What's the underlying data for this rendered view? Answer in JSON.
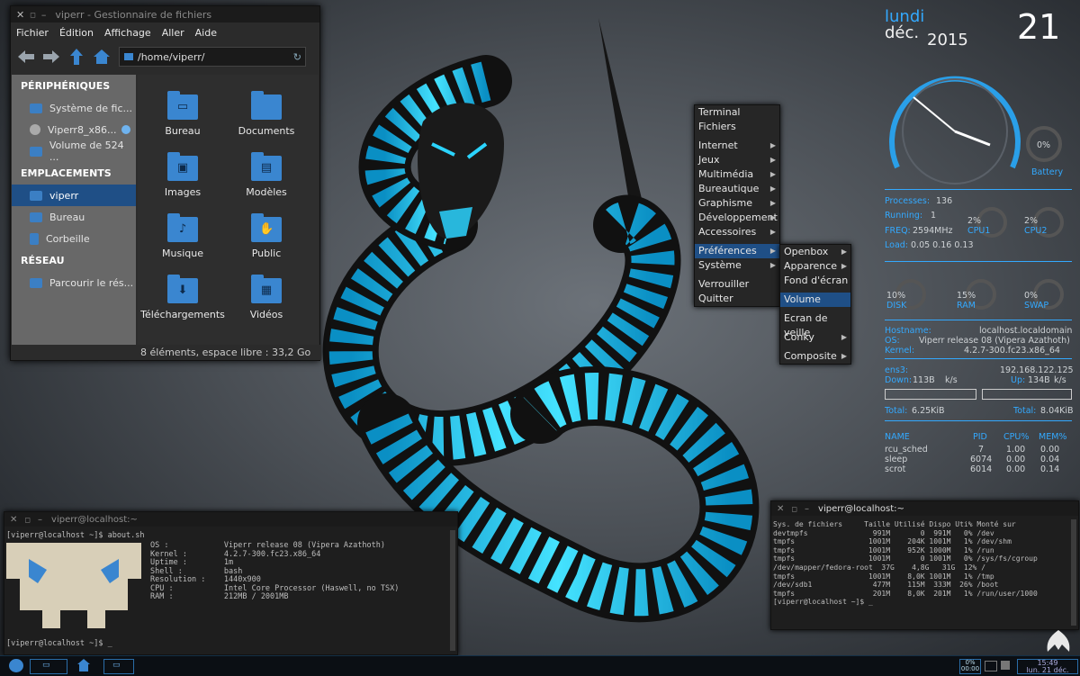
{
  "colors": {
    "accent": "#33a9ff",
    "selection": "#1f4f86",
    "folder": "#3a86d0",
    "snake_glow": "#2bd4ff"
  },
  "file_manager": {
    "title": "viperr - Gestionnaire de fichiers",
    "menus": [
      "Fichier",
      "Édition",
      "Affichage",
      "Aller",
      "Aide"
    ],
    "path": "/home/viperr/",
    "sections": [
      {
        "title": "PÉRIPHÉRIQUES",
        "items": [
          "Système de fic...",
          "Viperr8_x86...",
          "Volume de 524 ..."
        ]
      },
      {
        "title": "EMPLACEMENTS",
        "items": [
          "viperr",
          "Bureau",
          "Corbeille"
        ]
      },
      {
        "title": "RÉSEAU",
        "items": [
          "Parcourir le rés..."
        ]
      }
    ],
    "files": [
      "Bureau",
      "Documents",
      "Images",
      "Modèles",
      "Musique",
      "Public",
      "Téléchargements",
      "Vidéos"
    ],
    "status": "8 éléments, espace libre : 33,2 Go"
  },
  "menu": {
    "items": [
      "Terminal",
      "Fichiers",
      "Internet",
      "Jeux",
      "Multimédia",
      "Bureautique",
      "Graphisme",
      "Développement",
      "Accessoires",
      "Préférences",
      "Système",
      "Verrouiller",
      "Quitter"
    ],
    "submenu": [
      "Openbox",
      "Apparence",
      "Fond d'écran",
      "Volume",
      "Ecran de veille",
      "Conky",
      "Composite"
    ]
  },
  "conky": {
    "day": "lundi",
    "month": "déc.",
    "year": "2015",
    "date": "21",
    "battery_pct": "0%",
    "battery_label": "Battery",
    "processes_label": "Processes:",
    "processes": "136",
    "running_label": "Running:",
    "running": "1",
    "freq_label": "FREQ:",
    "freq": "2594MHz",
    "load_label": "Load:",
    "load": "0.05 0.16 0.13",
    "cpu1_pct": "2%",
    "cpu1_label": "CPU1",
    "cpu2_pct": "2%",
    "cpu2_label": "CPU2",
    "disk_pct": "10%",
    "disk_label": "DISK",
    "ram_pct": "15%",
    "ram_label": "RAM",
    "swap_pct": "0%",
    "swap_label": "SWAP",
    "hostname_label": "Hostname:",
    "hostname": "localhost.localdomain",
    "os_label": "OS:",
    "os": "Viperr release 08 (Vipera Azathoth)",
    "kernel_label": "Kernel:",
    "kernel": "4.2.7-300.fc23.x86_64",
    "iface_label": "ens3:",
    "ip": "192.168.122.125",
    "down_label": "Down:",
    "down": "113B",
    "down_unit": "k/s",
    "up_label": "Up:",
    "up": "134B",
    "up_unit": "k/s",
    "total_label": "Total:",
    "total_down": "6.25KiB",
    "total_up": "8.04KiB",
    "proc_headers": [
      "NAME",
      "PID",
      "CPU%",
      "MEM%"
    ],
    "procs": [
      [
        "rcu_sched",
        "7",
        "1.00",
        "0.00"
      ],
      [
        "sleep",
        "6074",
        "0.00",
        "0.04"
      ],
      [
        "scrot",
        "6014",
        "0.00",
        "0.14"
      ]
    ]
  },
  "term1": {
    "title": "viperr@localhost:~",
    "prompt1": "[viperr@localhost ~]$ about.sh",
    "info": "OS :            Viperr release 08 (Vipera Azathoth)\nKernel :        4.2.7-300.fc23.x86_64\nUptime :        1m\nShell :         bash\nResolution :    1440x900\nCPU :           Intel Core Processor (Haswell, no TSX)\nRAM :           212MB / 2001MB",
    "prompt2": "[viperr@localhost ~]$ _"
  },
  "term2": {
    "title": "viperr@localhost:~",
    "body": "Sys. de fichiers     Taille Utilisé Dispo Uti% Monté sur\ndevtmpfs               991M       0  991M   0% /dev\ntmpfs                 1001M    204K 1001M   1% /dev/shm\ntmpfs                 1001M    952K 1000M   1% /run\ntmpfs                 1001M       0 1001M   0% /sys/fs/cgroup\n/dev/mapper/fedora-root  37G    4,8G   31G  12% /\ntmpfs                 1001M    8,0K 1001M   1% /tmp\n/dev/sdb1              477M    115M  333M  26% /boot\ntmpfs                  201M    8,0K  201M   1% /run/user/1000\n[viperr@localhost ~]$ _"
  },
  "taskbar": {
    "vol": "0%",
    "net": "00:00",
    "time": "15:49",
    "date": "lun. 21 déc."
  }
}
